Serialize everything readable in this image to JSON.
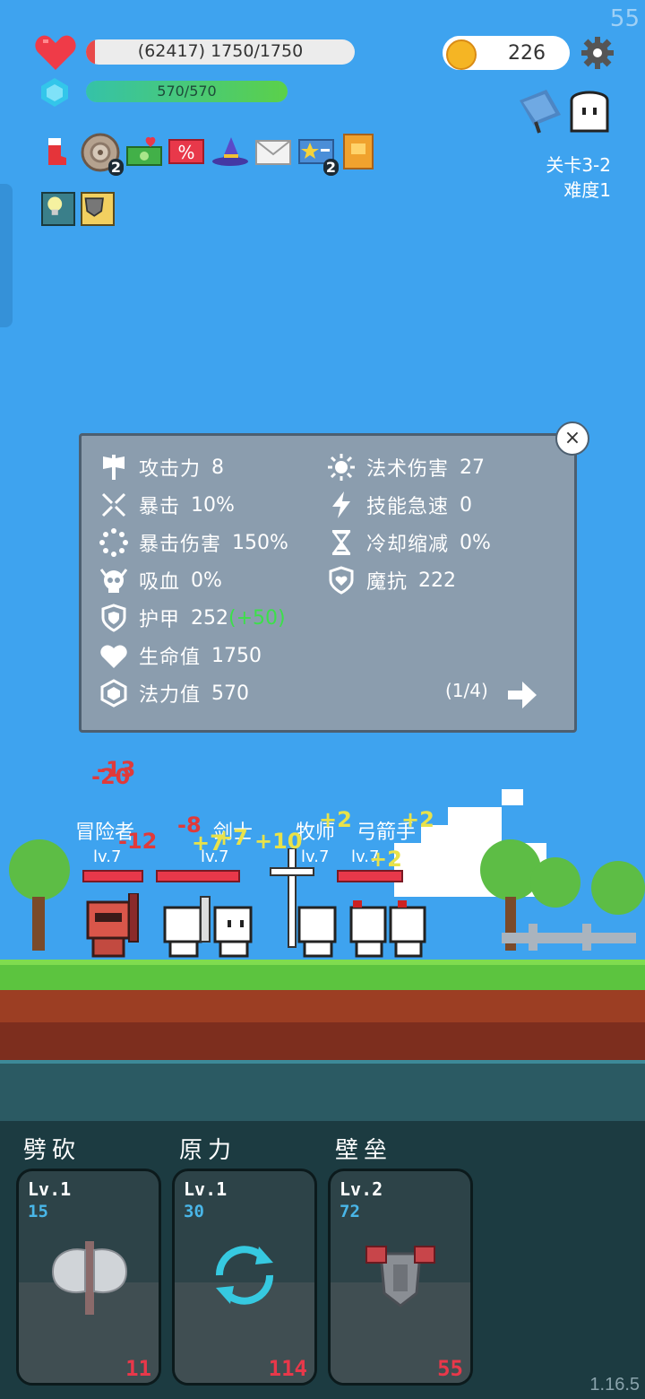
{
  "fps": "55",
  "version": "1.16.5",
  "hud": {
    "hp_text": "(62417) 1750/1750",
    "mp_text": "570/570",
    "mp_fraction": 1.0,
    "gold": "226",
    "stage": "关卡3-2",
    "difficulty": "难度1",
    "item_badges": [
      "2",
      "2"
    ]
  },
  "stats_panel": {
    "left": [
      {
        "label": "攻击力",
        "value": "8",
        "icon": "axe-icon"
      },
      {
        "label": "暴击",
        "value": "10%",
        "icon": "crit-icon"
      },
      {
        "label": "暴击伤害",
        "value": "150%",
        "icon": "crit-damage-icon"
      },
      {
        "label": "吸血",
        "value": "0%",
        "icon": "skull-icon"
      },
      {
        "label": "护甲",
        "value": "252",
        "bonus": "(+50)",
        "icon": "shield-icon"
      },
      {
        "label": "生命值",
        "value": "1750",
        "icon": "heart-icon"
      },
      {
        "label": "法力值",
        "value": "570",
        "icon": "crystal-icon"
      }
    ],
    "right": [
      {
        "label": "法术伤害",
        "value": "27",
        "icon": "sun-icon"
      },
      {
        "label": "技能急速",
        "value": "0",
        "icon": "lightning-icon"
      },
      {
        "label": "冷却缩减",
        "value": "0%",
        "icon": "hourglass-icon"
      },
      {
        "label": "魔抗",
        "value": "222",
        "icon": "magic-shield-icon"
      }
    ],
    "page": "(1/4)",
    "close": "×"
  },
  "battle": {
    "units": [
      {
        "name": "冒险者",
        "level": "lv.7"
      },
      {
        "name": "剑士",
        "level": "lv.7"
      },
      {
        "name": "牧师",
        "level": "lv.7"
      },
      {
        "name": "弓箭手",
        "level": "lv.7"
      }
    ],
    "floaters": [
      "-13",
      "-20",
      "-12",
      "-8",
      "+7",
      "+7",
      "+10",
      "+2",
      "+2",
      "+2"
    ]
  },
  "skills": [
    {
      "name": "劈砍",
      "level": "Lv.1",
      "cost": "15",
      "count": "11",
      "icon": "axe-skill-icon"
    },
    {
      "name": "原力",
      "level": "Lv.1",
      "cost": "30",
      "count": "114",
      "icon": "refresh-skill-icon"
    },
    {
      "name": "壁垒",
      "level": "Lv.2",
      "cost": "72",
      "count": "55",
      "icon": "armor-skill-icon"
    }
  ]
}
